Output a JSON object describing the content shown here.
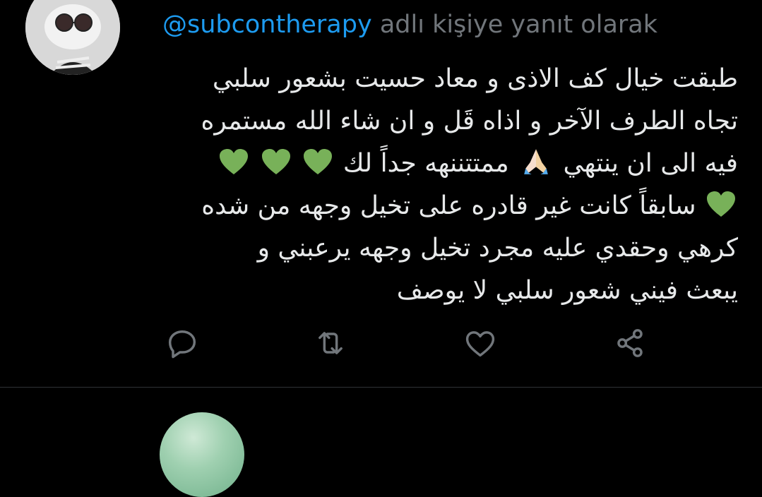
{
  "reply": {
    "handle": "@subcontherapy",
    "suffix": "adlı kişiye yanıt olarak"
  },
  "tweet": {
    "line1": "طبقت خيال كف الاذى و معاد حسيت بشعور سلبي",
    "line2": "تجاه الطرف الآخر و اذاه قَل و ان شاء الله مستمره",
    "line3_text": "فيه الى ان ينتهي",
    "line3_text2": "ممتتننهه جداً لك",
    "line4_text": "سابقاً كانت غير قادره على تخيل وجهه من شده",
    "line5": "كرهي وحقدي عليه مجرد تخيل وجهه يرعبني و",
    "line6": "يبعث فيني شعور سلبي لا يوصف"
  },
  "emoji": {
    "heart_color": "#78b159",
    "hands": "folded-hands"
  },
  "actions": [
    {
      "name": "reply",
      "icon": "reply-icon"
    },
    {
      "name": "retweet",
      "icon": "retweet-icon"
    },
    {
      "name": "like",
      "icon": "heart-icon"
    },
    {
      "name": "share",
      "icon": "share-icon"
    }
  ],
  "colors": {
    "background": "#000000",
    "text": "#e7e9ea",
    "muted": "#71767b",
    "link": "#1d9bf0",
    "divider": "#2f3336"
  }
}
